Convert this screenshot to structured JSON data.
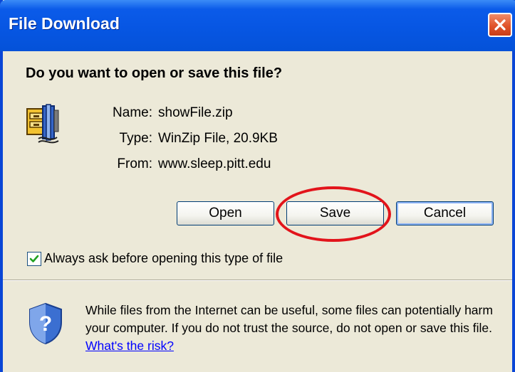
{
  "window": {
    "title": "File Download",
    "question": "Do you want to open or save this file?"
  },
  "file": {
    "icon": "zip-archive-icon",
    "name_label": "Name:",
    "name_value": "showFile.zip",
    "type_label": "Type:",
    "type_value": "WinZip File, 20.9KB",
    "from_label": "From:",
    "from_value": "www.sleep.pitt.edu"
  },
  "buttons": {
    "open": "Open",
    "save": "Save",
    "cancel": "Cancel"
  },
  "checkbox": {
    "label": "Always ask before opening this type of file",
    "checked": true
  },
  "warning": {
    "icon": "shield-question-icon",
    "text": "While files from the Internet can be useful, some files can potentially harm your computer. If you do not trust the source, do not open or save this file.",
    "link": "What's the risk?"
  },
  "colors": {
    "titlebar": "#0756e3",
    "dialog_bg": "#ece9d8",
    "highlight": "#e2141b",
    "link": "#0000ff"
  }
}
